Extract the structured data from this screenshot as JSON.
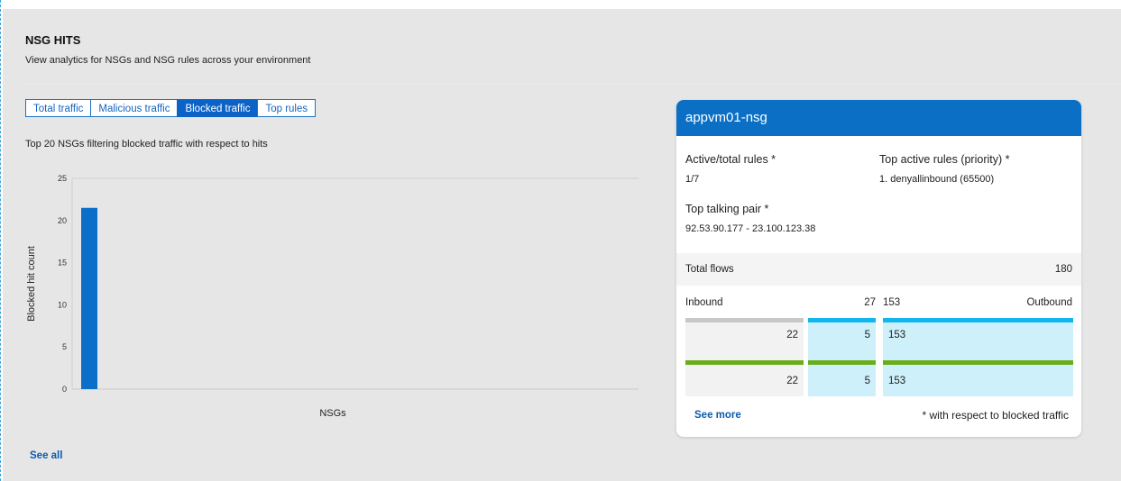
{
  "section": {
    "title": "NSG HITS",
    "subtitle": "View analytics for NSGs and NSG rules across your environment"
  },
  "tabs": [
    {
      "label": "Total traffic",
      "active": false
    },
    {
      "label": "Malicious traffic",
      "active": false
    },
    {
      "label": "Blocked traffic",
      "active": true
    },
    {
      "label": "Top rules",
      "active": false
    }
  ],
  "chart_description": "Top 20 NSGs filtering blocked traffic with respect to hits",
  "chart_data": {
    "type": "bar",
    "categories": [
      ""
    ],
    "values": [
      21.5
    ],
    "xlabel": "NSGs",
    "ylabel": "Blocked hit count",
    "ylim": [
      0,
      25
    ],
    "yticks": [
      0,
      5,
      10,
      15,
      20,
      25
    ],
    "grid": true,
    "bar_color": "#0b6fca"
  },
  "see_all_label": "See all",
  "card": {
    "title": "appvm01-nsg",
    "active_total_rules_label": "Active/total rules *",
    "active_total_rules_value": "1/7",
    "top_active_rules_label": "Top active rules (priority) *",
    "top_active_rules_value": "1. denyallinbound (65500)",
    "top_talking_pair_label": "Top talking pair *",
    "top_talking_pair_value": "92.53.90.177 - 23.100.123.38",
    "total_flows_label": "Total flows",
    "total_flows_value": "180",
    "inbound_label": "Inbound",
    "inbound_value": "27",
    "outbound_value": "153",
    "outbound_label": "Outbound",
    "row1": {
      "left": "22",
      "mid": "5",
      "right": "153"
    },
    "row2": {
      "left": "22",
      "mid": "5",
      "right": "153"
    },
    "see_more_label": "See more",
    "footnote": "* with respect to blocked traffic",
    "colors": {
      "header": "#0a6fc5",
      "gray_bar": "#c8c8c8",
      "blue_bar": "#12b6ee",
      "green_bar": "#6aad1a",
      "light_blue_cell": "#cdf0fb",
      "gray_cell": "#f2f2f2"
    }
  }
}
